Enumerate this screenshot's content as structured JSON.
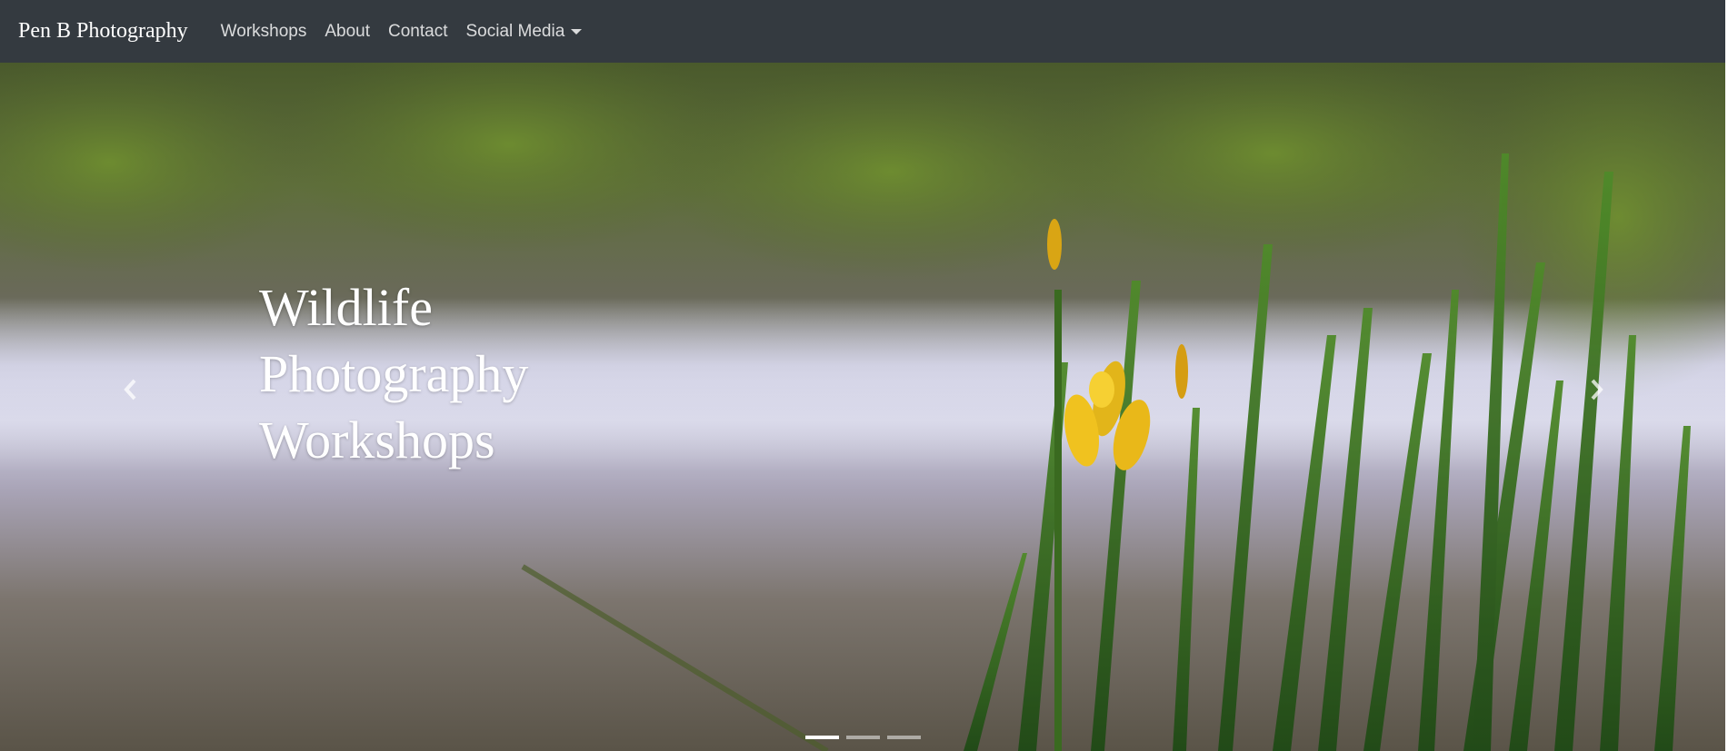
{
  "navbar": {
    "brand": "Pen B Photography",
    "links": [
      {
        "label": "Workshops"
      },
      {
        "label": "About"
      },
      {
        "label": "Contact"
      },
      {
        "label": "Social Media",
        "dropdown": true
      }
    ],
    "background_color": "#343a40"
  },
  "hero": {
    "caption_lines": [
      "Wildlife",
      "Photography",
      "Workshops"
    ],
    "image_description_icon": "misty-lake-with-yellow-iris-photo",
    "slide_count": 3,
    "active_slide": 1,
    "prev_icon": "chevron-left-icon",
    "next_icon": "chevron-right-icon"
  }
}
